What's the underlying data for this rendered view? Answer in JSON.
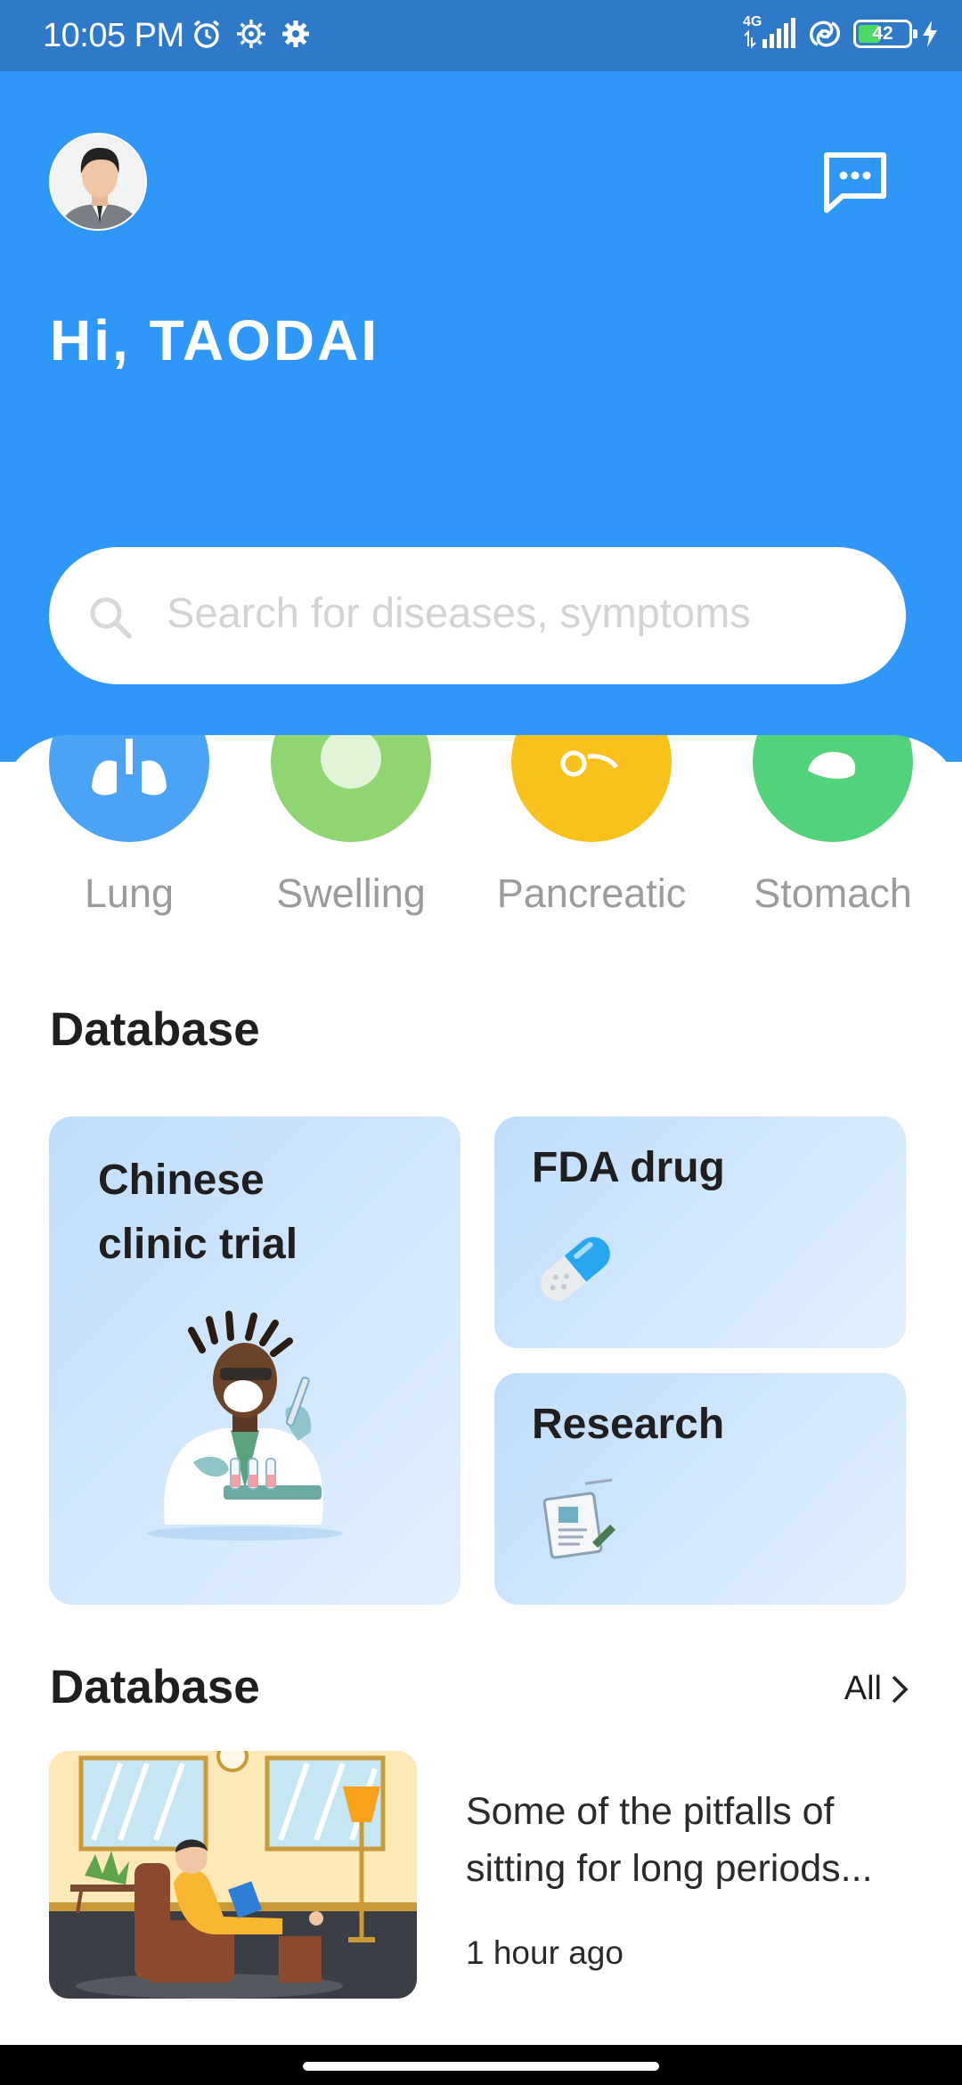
{
  "status_bar": {
    "time": "10:05 PM",
    "network": "4G",
    "battery": "42",
    "icons_left": [
      "alarm-icon",
      "settings-outline-icon",
      "gear-icon"
    ],
    "icons_right": [
      "signal-icon",
      "wifi-hotspot-icon",
      "battery-icon",
      "charging-icon"
    ]
  },
  "header": {
    "greeting": "Hi, TAODAI",
    "avatar": "avatar-icon",
    "message_icon": "chat-bubble-icon",
    "background_color": "#2e97f8"
  },
  "search": {
    "placeholder": "Search for diseases, symptoms",
    "value": "",
    "icon": "search-icon"
  },
  "categories": [
    {
      "label": "Lung",
      "color": "#4aa3f5",
      "icon": "lung-icon"
    },
    {
      "label": "Swelling",
      "color": "#8fd673",
      "icon": "swelling-icon"
    },
    {
      "label": "Pancreatic",
      "color": "#f9c11b",
      "icon": "pancreas-icon"
    },
    {
      "label": "Stomach",
      "color": "#52d27a",
      "icon": "stomach-icon"
    }
  ],
  "database_section": {
    "title": "Database",
    "cards": [
      {
        "line1": "Chinese",
        "line2": "clinic trial",
        "icon": "doctor-illustration"
      },
      {
        "label": "FDA drug",
        "icon": "pill-capsule-icon"
      },
      {
        "label": "Research",
        "icon": "research-document-icon"
      }
    ]
  },
  "articles_section": {
    "title": "Database",
    "all_label": "All",
    "all_icon": "chevron-right-icon",
    "items": [
      {
        "title": "Some of the pitfalls of sitting for long periods...",
        "time": "1 hour ago",
        "thumb_icon": "reading-man-illustration"
      }
    ]
  },
  "colors": {
    "accent": "#2e97f8",
    "card_start": "#bfddfb",
    "card_end": "#e2f0fd",
    "muted_text": "#9b9b9f"
  }
}
